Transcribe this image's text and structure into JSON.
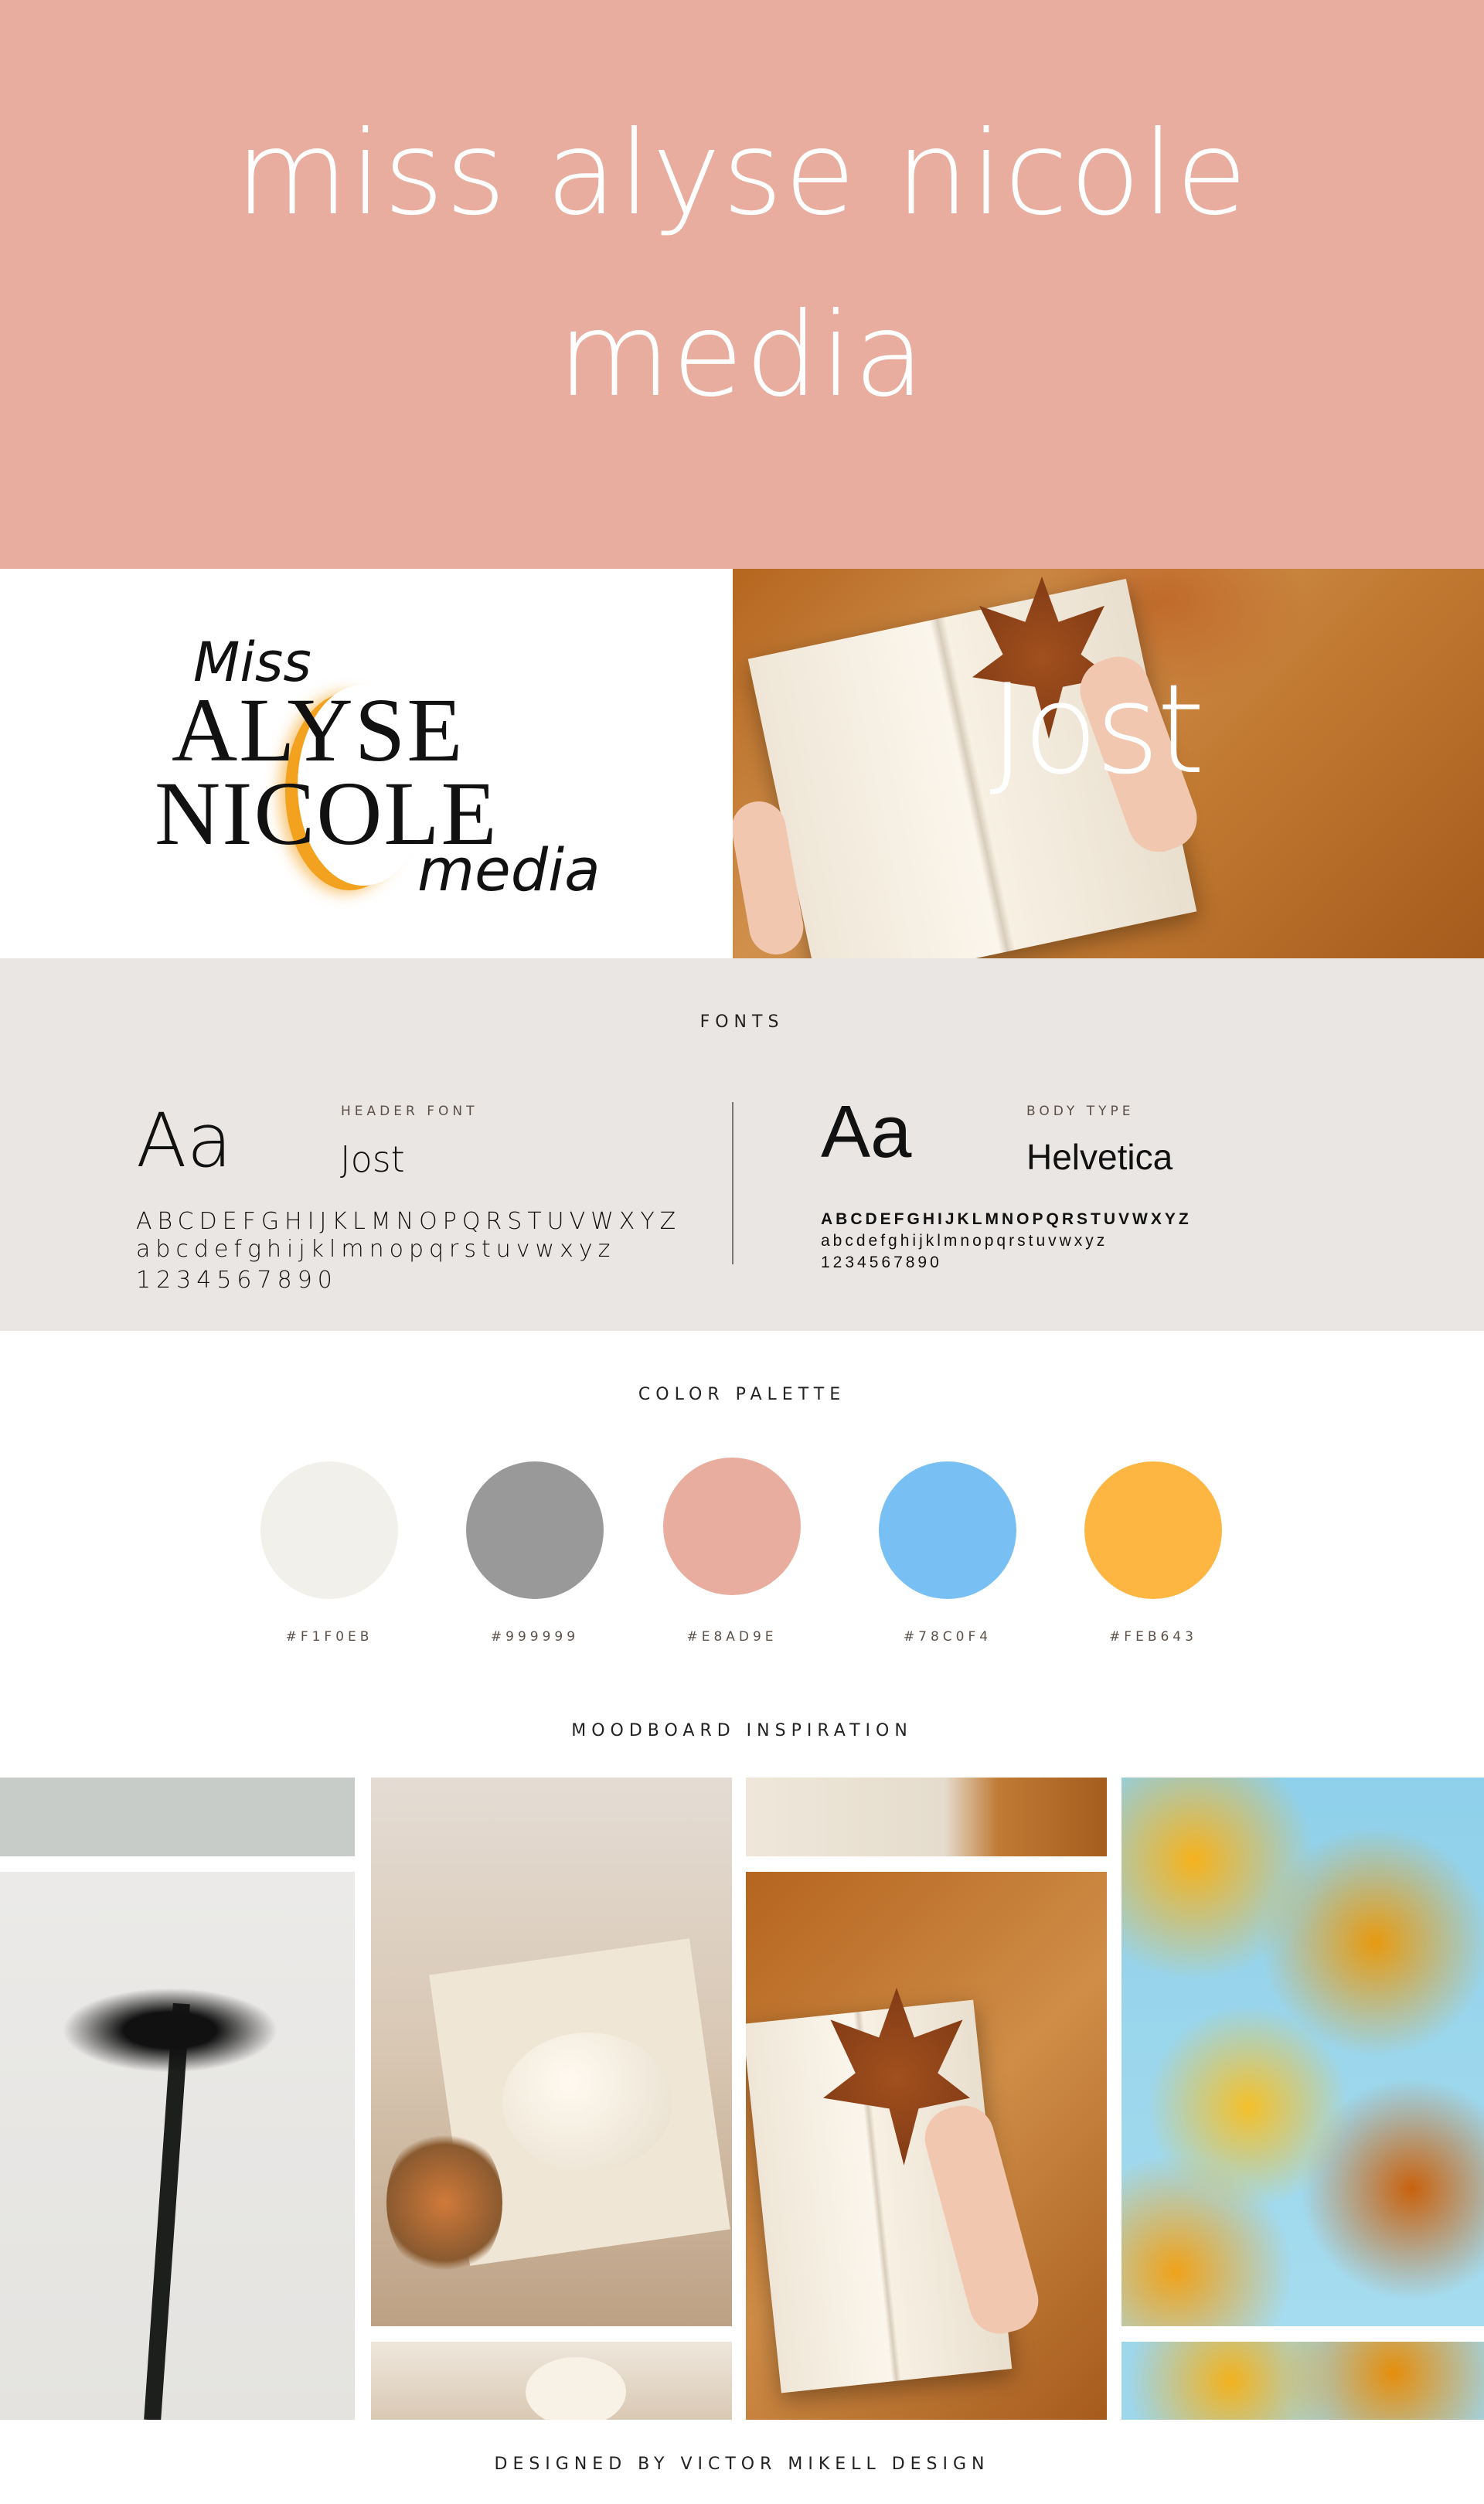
{
  "header": {
    "title_line1": "miss alyse nicole",
    "title_line2": "media",
    "background": "#E8AD9E"
  },
  "logo": {
    "line1": "Miss",
    "line2": "ALYSE",
    "line3": "NICOLE",
    "line4": "media"
  },
  "hero_photo": {
    "overlay_text": "Jost"
  },
  "fonts": {
    "title": "FONTS",
    "header_font": {
      "sample": "Aa",
      "label": "HEADER FONT",
      "name": "Jost",
      "upper": "ABCDEFGHIJKLMNOPQRSTUVWXYZ",
      "lower": "abcdefghijklmnopqrstuvwxyz",
      "digits": "1234567890"
    },
    "body_font": {
      "sample": "Aa",
      "label": "BODY TYPE",
      "name": "Helvetica",
      "upper": "ABCDEFGHIJKLMNOPQRSTUVWXYZ",
      "lower": "abcdefghijklmnopqrstuvwxyz",
      "digits": "1234567890"
    }
  },
  "palette": {
    "title": "COLOR PALETTE",
    "colors": [
      {
        "hex": "#F1F0EB",
        "label": "#F1F0EB"
      },
      {
        "hex": "#999999",
        "label": "#999999"
      },
      {
        "hex": "#E8AD9E",
        "label": "#E8AD9E"
      },
      {
        "hex": "#78C0F4",
        "label": "#78C0F4"
      },
      {
        "hex": "#FEB643",
        "label": "#FEB643"
      }
    ]
  },
  "moodboard": {
    "title": "MOODBOARD INSPIRATION"
  },
  "footer": {
    "credit": "DESIGNED BY VICTOR MIKELL DESIGN"
  }
}
